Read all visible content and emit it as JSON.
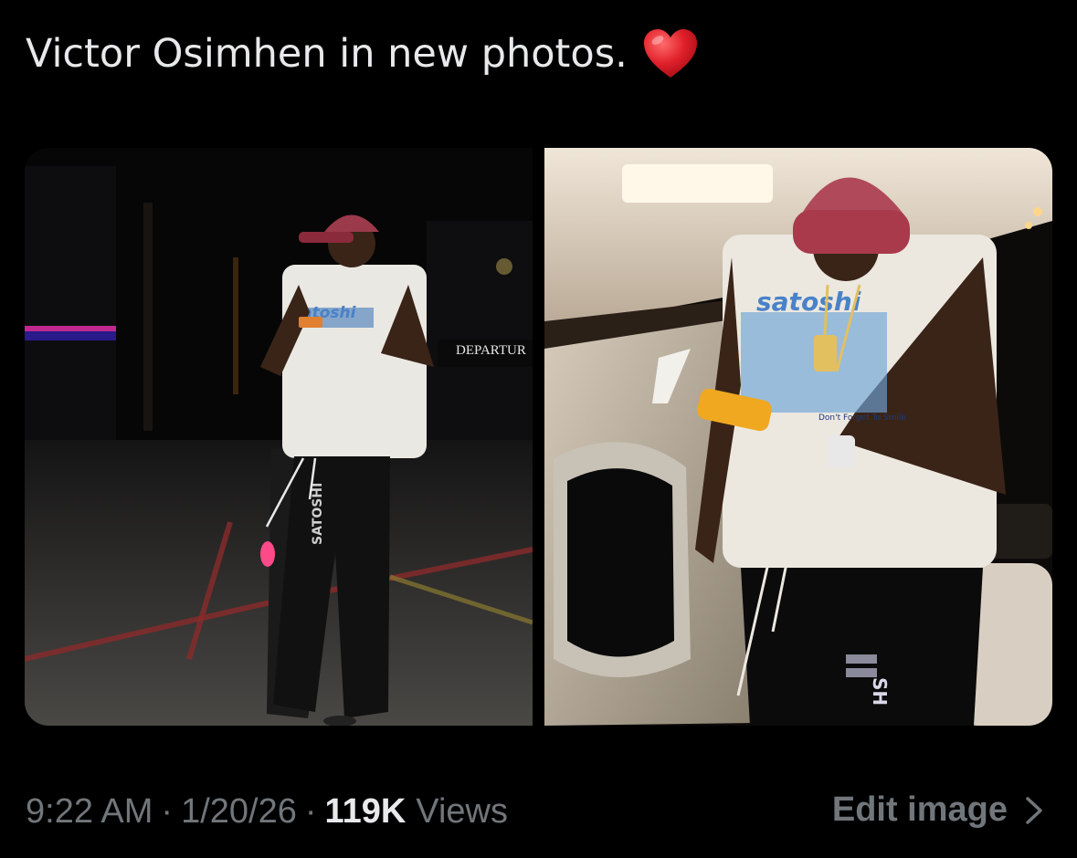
{
  "tweet": {
    "text": "Victor Osimhen in new photos.",
    "emoji": "heart-icon"
  },
  "media": {
    "photo_left": {
      "sign_text": "DEPARTUR",
      "shirt_text": "satoshi",
      "pants_text": "SATOSHI"
    },
    "photo_right": {
      "shirt_text": "satoshi",
      "shirt_subtext": "Don't Forget To Smile",
      "pants_text": "SH"
    }
  },
  "meta": {
    "time": "9:22 AM",
    "separator": "·",
    "date": "1/20/26",
    "views_count": "119K",
    "views_label": "Views"
  },
  "actions": {
    "edit_image_label": "Edit image",
    "edit_image_icon": "chevron-right-icon"
  },
  "colors": {
    "background": "#000000",
    "text_primary": "#e7e9ea",
    "text_secondary": "#71767b",
    "heart": "#e0202a"
  }
}
